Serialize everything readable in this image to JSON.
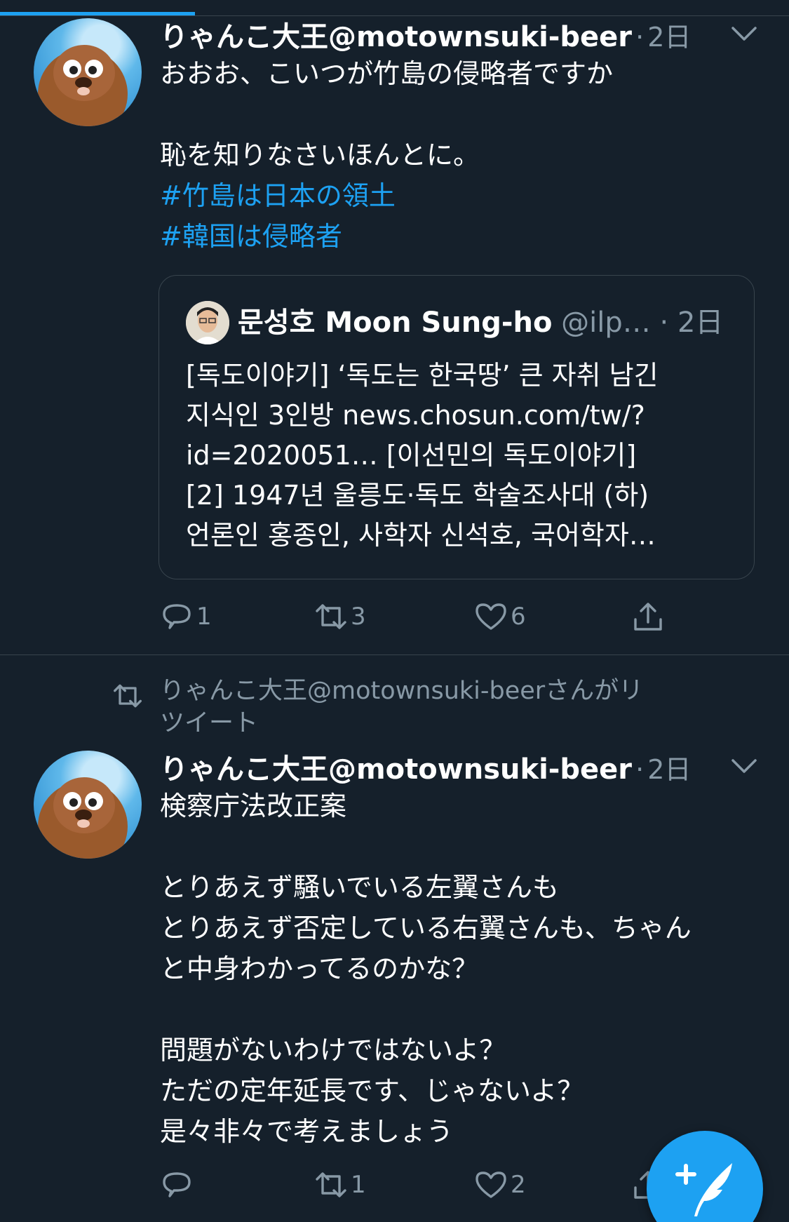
{
  "tweet1": {
    "display_name": "りゃんこ大王@motownsuki-beer",
    "dot": "·",
    "time": "2日",
    "lines": [
      "おおお、こいつが竹島の侵略者ですか",
      "",
      "恥を知りなさいほんとに。"
    ],
    "hashtags": [
      "#竹島は日本の領土",
      "#韓国は侵略者"
    ],
    "quote": {
      "name": "문성호 Moon Sung-ho",
      "handle": "@ilp…",
      "dot": "·",
      "time": "2日",
      "lines": [
        "[독도이야기] ‘독도는 한국땅’ 큰 자취 남긴",
        "지식인 3인방 news.chosun.com/tw/?",
        "id=2020051… [이선민의 독도이야기]",
        "[2] 1947년 울릉도·독도 학술조사대 (하)",
        "언론인 홍종인, 사학자 신석호, 국어학자…"
      ]
    },
    "actions": {
      "reply_count": "1",
      "retweet_count": "3",
      "like_count": "6"
    }
  },
  "retweet_notice": {
    "lines": [
      "りゃんこ大王@motownsuki-beerさんがリ",
      "ツイート"
    ]
  },
  "tweet2": {
    "display_name": "りゃんこ大王@motownsuki-beer",
    "dot": "·",
    "time": "2日",
    "lines": [
      "検察庁法改正案",
      "",
      "とりあえず騒いでいる左翼さんも",
      "とりあえず否定している右翼さんも、ちゃん",
      "と中身わかってるのかな？",
      "",
      "問題がないわけではないよ？",
      "ただの定年延長です、じゃないよ？",
      "是々非々で考えましょう"
    ],
    "actions": {
      "reply_count": "",
      "retweet_count": "1",
      "like_count": "2"
    }
  },
  "colors": {
    "background": "#15202b",
    "accent": "#1da1f2",
    "secondary_text": "#8899a6",
    "border": "#38444d"
  },
  "icons": [
    "reply-icon",
    "retweet-icon",
    "like-icon",
    "share-icon",
    "chevron-down-icon",
    "compose-tweet-icon"
  ]
}
